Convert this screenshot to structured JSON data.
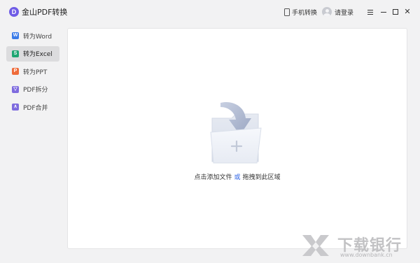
{
  "app": {
    "logo_letter": "D",
    "title": "金山PDF转换"
  },
  "header": {
    "phone_label": "手机转换",
    "login_label": "请登录",
    "menu_icon": "hamburger-menu-icon",
    "minimize_icon": "minimize-icon",
    "maximize_icon": "maximize-icon",
    "close_glyph": "✕"
  },
  "sidebar": {
    "items": [
      {
        "label": "转为Word",
        "icon": "word-icon",
        "glyph": "W",
        "color": "#3a7be8",
        "active": false
      },
      {
        "label": "转为Excel",
        "icon": "excel-icon",
        "glyph": "S",
        "color": "#1ea672",
        "active": true
      },
      {
        "label": "转为PPT",
        "icon": "ppt-icon",
        "glyph": "P",
        "color": "#ef6b3a",
        "active": false
      },
      {
        "label": "PDF拆分",
        "icon": "split-icon",
        "glyph": "▽",
        "color": "#7e6bde",
        "active": false
      },
      {
        "label": "PDF合并",
        "icon": "merge-icon",
        "glyph": "∧",
        "color": "#7e6bde",
        "active": false
      }
    ]
  },
  "main": {
    "drop_prefix": "点击添加文件",
    "drop_or": "或",
    "drop_suffix": "拖拽到此区域"
  },
  "watermark": {
    "text": "下载银行",
    "url": "www.downbank.cn"
  },
  "colors": {
    "accent": "#6f5ce6",
    "link": "#2e64e6",
    "background": "#f2f2f3"
  }
}
